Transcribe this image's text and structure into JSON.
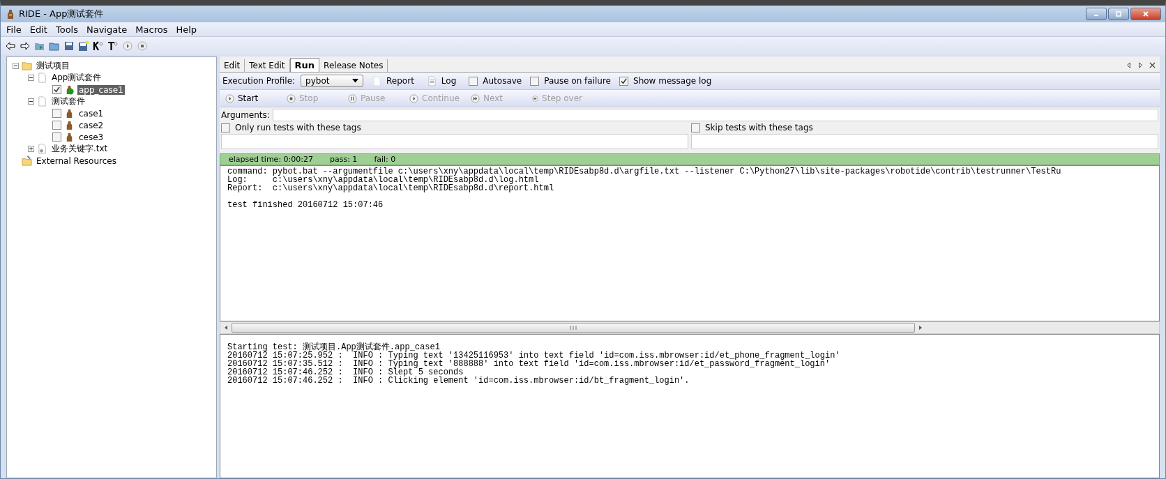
{
  "window": {
    "title": "RIDE - App测试套件"
  },
  "menu": [
    "File",
    "Edit",
    "Tools",
    "Navigate",
    "Macros",
    "Help"
  ],
  "tree": [
    {
      "label": "测试项目",
      "kind": "folder",
      "expanded": true,
      "children": [
        {
          "label": "App测试套件",
          "kind": "suite",
          "expanded": true,
          "children": [
            {
              "label": "app_case1",
              "kind": "test",
              "checked": true,
              "selected": true,
              "running": true
            }
          ]
        },
        {
          "label": "测试套件",
          "kind": "suite",
          "expanded": true,
          "children": [
            {
              "label": "case1",
              "kind": "test",
              "checked": false,
              "selected": false,
              "running": false
            },
            {
              "label": "case2",
              "kind": "test",
              "checked": false,
              "selected": false,
              "running": false
            },
            {
              "label": "cese3",
              "kind": "test",
              "checked": false,
              "selected": false,
              "running": false
            }
          ]
        },
        {
          "label": "业务关键字.txt",
          "kind": "resource",
          "expanded": false
        }
      ]
    },
    {
      "label": "External Resources",
      "kind": "external"
    }
  ],
  "tabs": [
    {
      "label": "Edit",
      "selected": false
    },
    {
      "label": "Text Edit",
      "selected": false
    },
    {
      "label": "Run",
      "selected": true
    },
    {
      "label": "Release Notes",
      "selected": false
    }
  ],
  "profile": {
    "label": "Execution Profile:",
    "value": "pybot"
  },
  "links": [
    {
      "label": "Report",
      "kind": "report"
    },
    {
      "label": "Log",
      "kind": "log"
    }
  ],
  "options": [
    {
      "label": "Autosave",
      "checked": false
    },
    {
      "label": "Pause on failure",
      "checked": false
    },
    {
      "label": "Show message log",
      "checked": true
    }
  ],
  "run_buttons": [
    {
      "label": "Start",
      "kind": "play",
      "disabled": false
    },
    {
      "label": "Stop",
      "kind": "stop",
      "disabled": true
    },
    {
      "label": "Pause",
      "kind": "pause",
      "disabled": true
    },
    {
      "label": "Continue",
      "kind": "play",
      "disabled": true
    },
    {
      "label": "Next",
      "kind": "next",
      "disabled": true
    },
    {
      "label": "Step over",
      "kind": "next",
      "disabled": true
    }
  ],
  "arguments": {
    "label": "Arguments:"
  },
  "tag_filters": [
    {
      "label": "Only run tests with these tags",
      "checked": false
    },
    {
      "label": "Skip tests with these tags",
      "checked": false
    }
  ],
  "status": {
    "elapsed": "elapsed time: 0:00:27",
    "pass": "pass: 1",
    "fail": "fail: 0"
  },
  "output": {
    "lines": [
      "command: pybot.bat --argumentfile c:\\users\\xny\\appdata\\local\\temp\\RIDEsabp8d.d\\argfile.txt --listener C:\\Python27\\lib\\site-packages\\robotide\\contrib\\testrunner\\TestRu",
      "Log:     c:\\users\\xny\\appdata\\local\\temp\\RIDEsabp8d.d\\log.html",
      "Report:  c:\\users\\xny\\appdata\\local\\temp\\RIDEsabp8d.d\\report.html"
    ],
    "result": "test finished 20160712 15:07:46"
  },
  "message_log": [
    "Starting test: 测试项目.App测试套件.app_case1",
    "20160712 15:07:25.952 :  INFO : Typing text '13425116953' into text field 'id=com.iss.mbrowser:id/et_phone_fragment_login'",
    "20160712 15:07:35.512 :  INFO : Typing text '888888' into text field 'id=com.iss.mbrowser:id/et_password_fragment_login'",
    "20160712 15:07:46.252 :  INFO : Slept 5 seconds",
    "20160712 15:07:46.252 :  INFO : Clicking element 'id=com.iss.mbrowser:id/bt_fragment_login'."
  ]
}
